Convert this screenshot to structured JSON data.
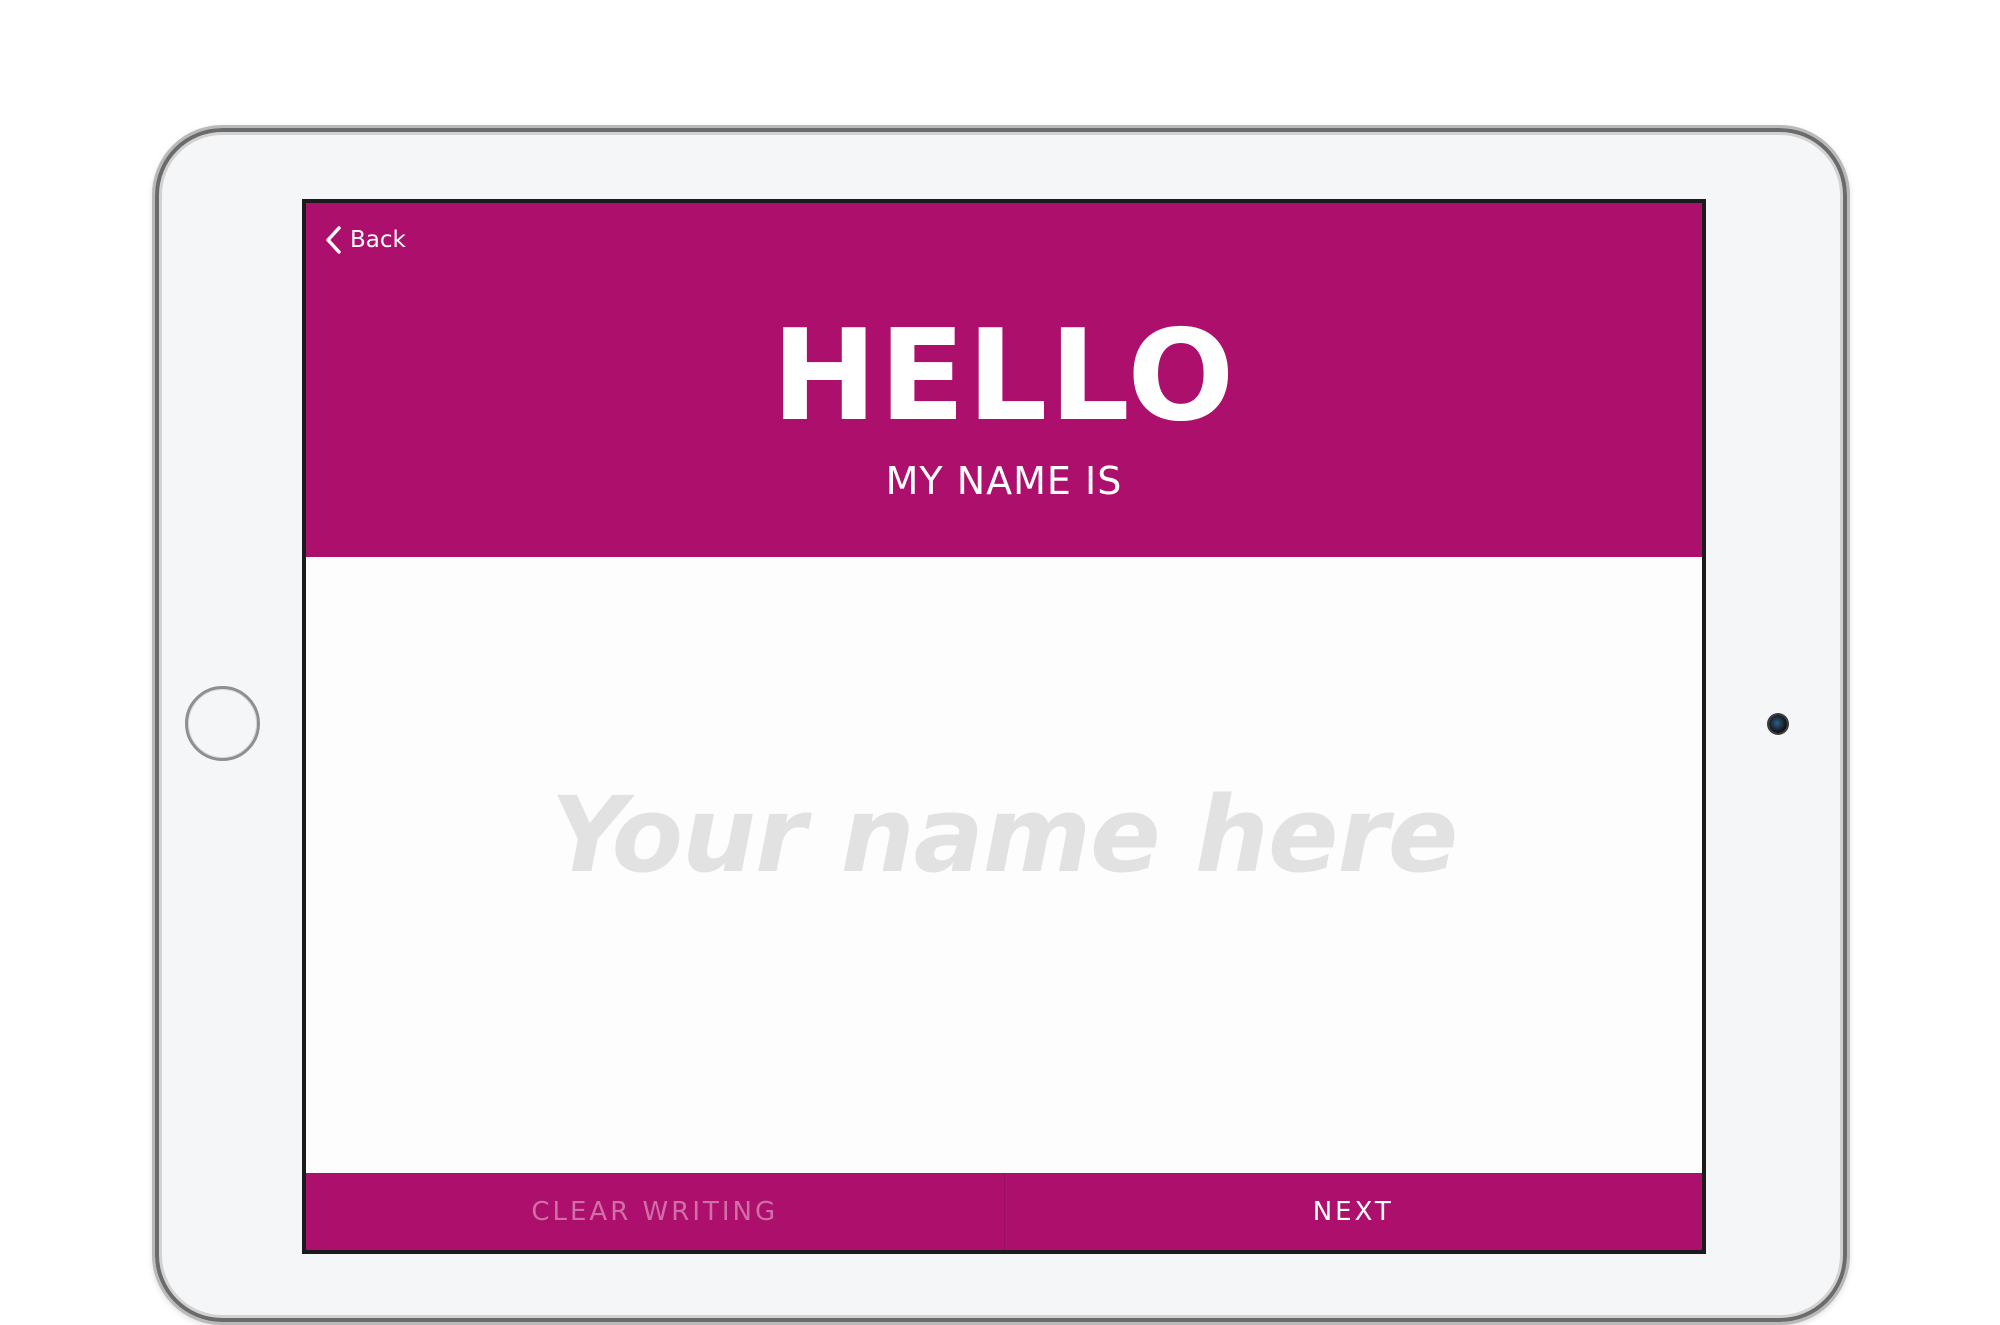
{
  "app": {
    "back_label": "Back",
    "heading": "HELLO",
    "subheading": "MY NAME IS"
  },
  "canvas": {
    "placeholder": "Your name here"
  },
  "footer": {
    "clear_label": "CLEAR WRITING",
    "next_label": "NEXT"
  },
  "colors": {
    "brand": "#ad106c",
    "placeholder_text": "#e2e2e2",
    "disabled_button_text": "#cf6fa6"
  },
  "icons": {
    "back": "chevron-left-icon",
    "home": "home-button-icon",
    "camera": "camera-icon"
  }
}
